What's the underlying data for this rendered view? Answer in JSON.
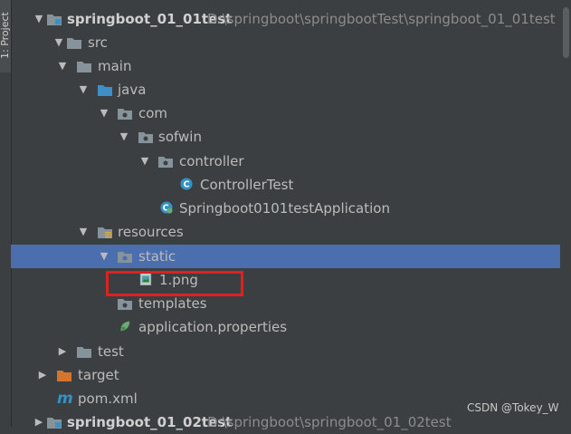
{
  "side_panel": {
    "label": "1: Project"
  },
  "tree": {
    "project1": {
      "name": "springboot_01_01test",
      "path": "D:\\springboot\\springbootTest\\springboot_01_01test"
    },
    "src": "src",
    "main": "main",
    "java": "java",
    "com": "com",
    "sofwin": "sofwin",
    "controller": "controller",
    "controller_test": "ControllerTest",
    "app_class": "Springboot0101testApplication",
    "resources": "resources",
    "static": "static",
    "png_file": "1.png",
    "templates": "templates",
    "app_props": "application.properties",
    "test": "test",
    "target": "target",
    "pom": "pom.xml",
    "project2": {
      "name": "springboot_01_02test",
      "path": "D:\\springboot\\springboot_01_02test"
    }
  },
  "watermark": "CSDN @Tokey_W",
  "colors": {
    "background": "#3c3f41",
    "selection": "#4b6eaf",
    "highlight_border": "#e02020",
    "folder": "#87939a",
    "source_folder": "#3d8fc6",
    "excluded_folder": "#d5752d",
    "class_icon": "#3592c4"
  }
}
